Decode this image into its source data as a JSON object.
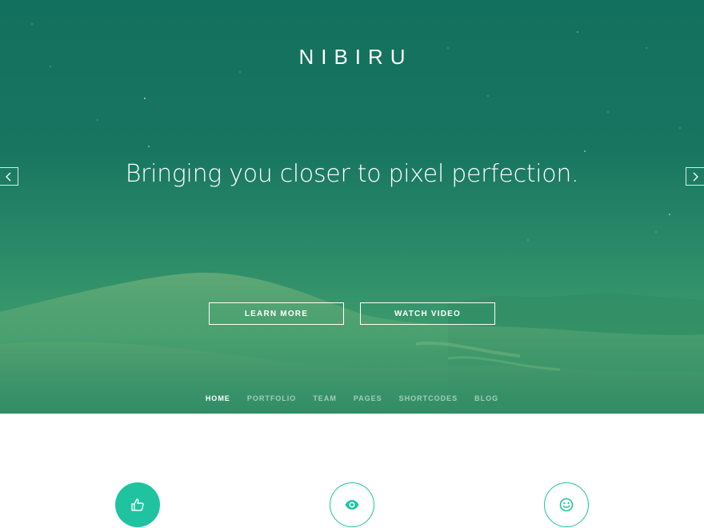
{
  "brand": {
    "name": "NIBIRU"
  },
  "hero": {
    "headline": "Bringing you closer to pixel perfection.",
    "prev_icon": "chevron-left-icon",
    "next_icon": "chevron-right-icon"
  },
  "buttons": {
    "learn_more": "LEARN MORE",
    "watch_video": "WATCH VIDEO"
  },
  "nav": {
    "items": [
      {
        "label": "HOME",
        "active": true
      },
      {
        "label": "PORTFOLIO",
        "active": false
      },
      {
        "label": "TEAM",
        "active": false
      },
      {
        "label": "PAGES",
        "active": false
      },
      {
        "label": "SHORTCODES",
        "active": false
      },
      {
        "label": "BLOG",
        "active": false
      }
    ]
  },
  "features": {
    "icons": [
      "thumbs-up-icon",
      "eye-icon",
      "smiley-icon"
    ]
  },
  "colors": {
    "accent": "#1fc3a0",
    "hero_overlay": "#177560",
    "text_light": "#ffffff"
  }
}
